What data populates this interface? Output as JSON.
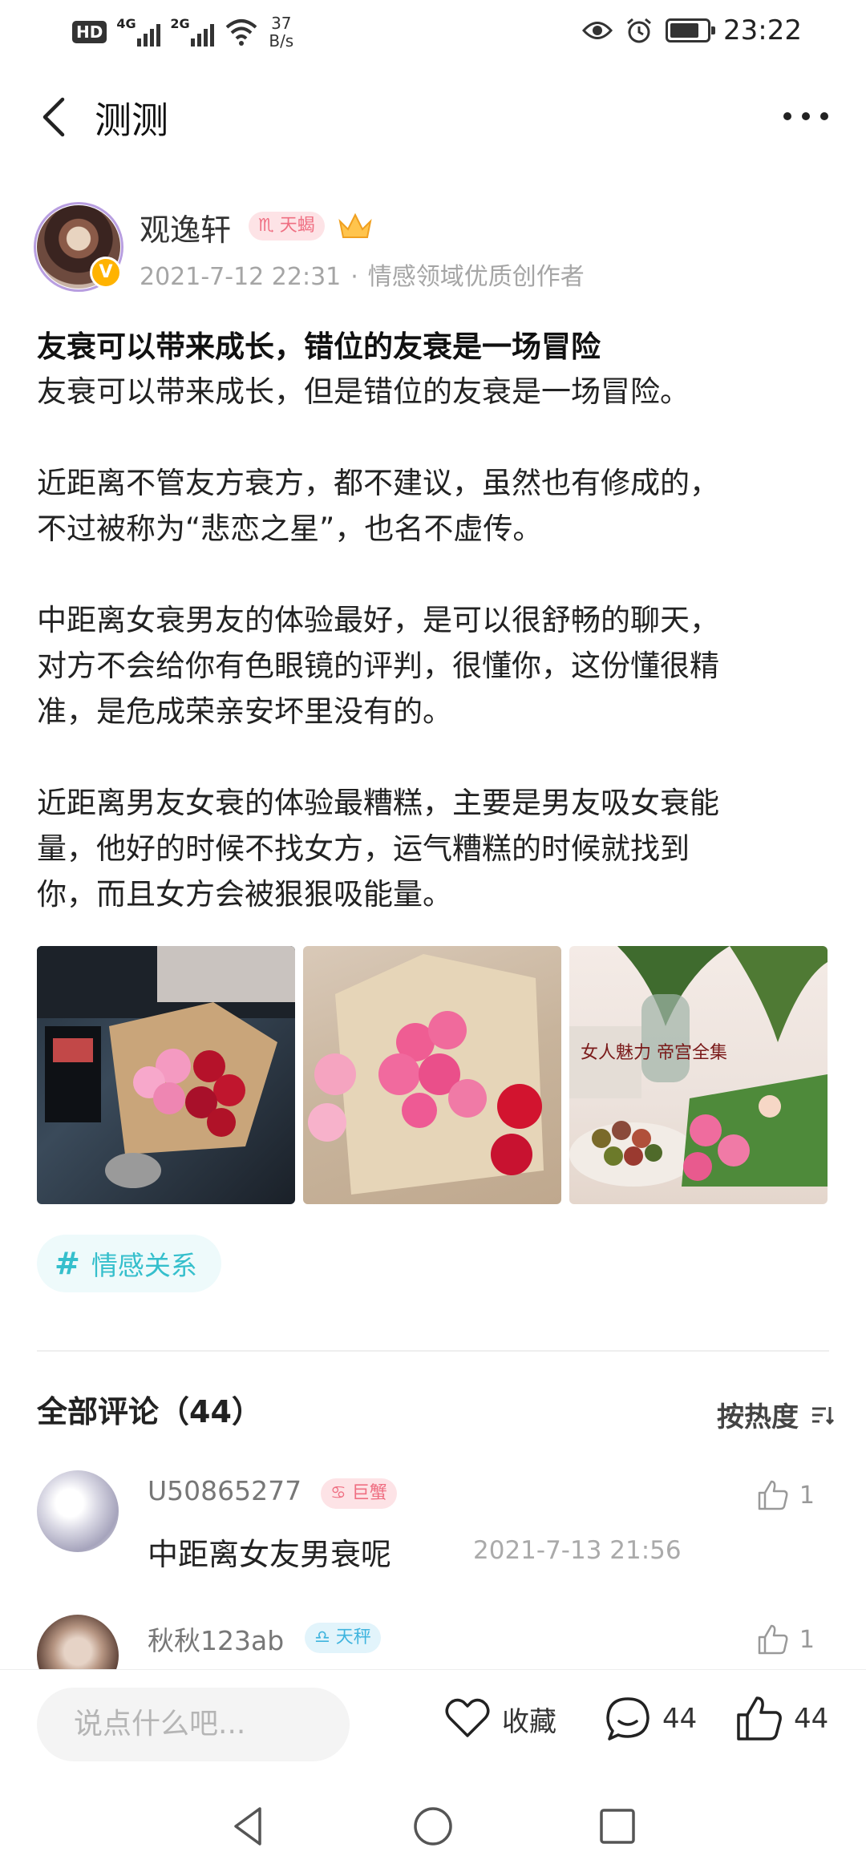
{
  "status_bar": {
    "hd": "HD",
    "sim1": "4G",
    "sim2": "2G",
    "speed_value": "37",
    "speed_unit": "B/s",
    "time": "23:22",
    "battery_level": 0.8
  },
  "titlebar": {
    "title": "测测"
  },
  "author": {
    "name": "观逸轩",
    "zodiac": "♏ 天蝎",
    "vip_badge": "V",
    "date": "2021-7-12 22:31",
    "separator": "·",
    "role": "情感领域优质创作者"
  },
  "post": {
    "title": "友衰可以带来成长，错位的友衰是一场冒险",
    "paragraphs": [
      "友衰可以带来成长，但是错位的友衰是一场冒险。",
      "近距离不管友方衰方，都不建议，虽然也有修成的，\n不过被称为“悲恋之星”，也名不虚传。",
      "中距离女衰男友的体验最好，是可以很舒畅的聊天，\n对方不会给你有色眼镜的评判，很懂你，这份懂很精\n准，是危成荣亲安坏里没有的。",
      "近距离男友女衰的体验最糟糕，主要是男友吸女衰能\n量，他好的时候不找女方，运气糟糕的时候就找到\n你，而且女方会被狠狠吸能量。"
    ],
    "photo3_caption": "女人魅力 帝宫全集",
    "topic": "情感关系"
  },
  "comments": {
    "header": "全部评论（44）",
    "sort_label": "按热度",
    "items": [
      {
        "user": "U50865277",
        "zodiac": "♋ 巨蟹",
        "likes": "1",
        "text": "中距离女友男衰呢",
        "time": "2021-7-13 21:56"
      },
      {
        "user": "秋秋123ab",
        "zodiac": "♎ 天秤",
        "likes": "1",
        "text": "",
        "time": ""
      }
    ]
  },
  "actionbar": {
    "input_placeholder": "说点什么吧...",
    "favorite_label": "收藏",
    "comment_count": "44",
    "like_count": "44"
  },
  "colors": {
    "accent_teal": "#35bfcc",
    "scorpio_pink": "#ef6f82",
    "libra_blue": "#3fb4de"
  }
}
